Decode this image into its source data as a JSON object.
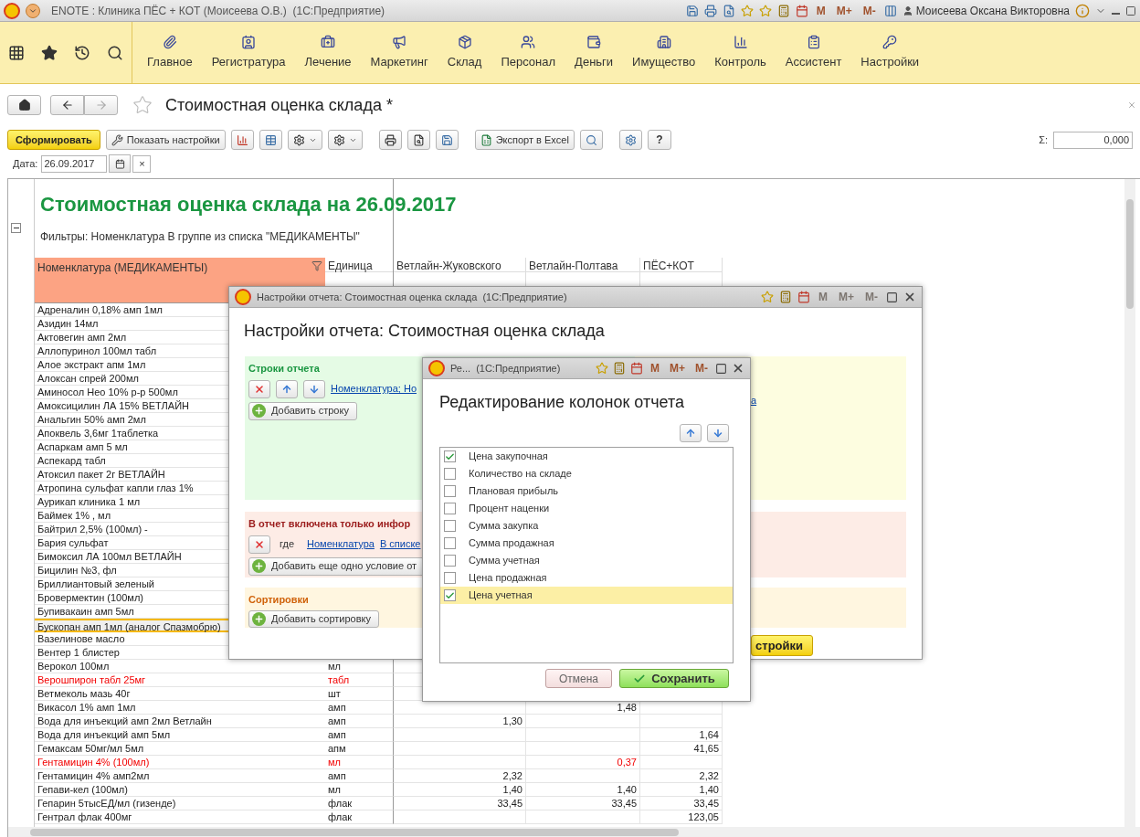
{
  "app_title_bar": {
    "title": "ENOTE : Клиника ПЁС + КОТ (Моисеева О.В.)  (1С:Предприятие)",
    "memory_buttons": [
      "M",
      "M+",
      "M-"
    ],
    "user": "Моисеева Оксана Викторовна"
  },
  "sections": [
    {
      "label": "Главное"
    },
    {
      "label": "Регистратура"
    },
    {
      "label": "Лечение"
    },
    {
      "label": "Маркетинг"
    },
    {
      "label": "Склад"
    },
    {
      "label": "Персонал"
    },
    {
      "label": "Деньги"
    },
    {
      "label": "Имущество"
    },
    {
      "label": "Контроль"
    },
    {
      "label": "Ассистент"
    },
    {
      "label": "Настройки"
    }
  ],
  "page": {
    "title": "Стоимостная оценка склада *"
  },
  "toolbar": {
    "generate_button": "Сформировать",
    "settings_button": "Показать настройки",
    "export_button": "Экспорт в Excel",
    "help_button": "?",
    "sum_label": "Σ:",
    "sum_value": "0,000"
  },
  "date_filter": {
    "label": "Дата:",
    "value": "26.09.2017",
    "clear": "×"
  },
  "report": {
    "title": "Стоимостная оценка склада на 26.09.2017",
    "filters": "Фильтры: Номенклатура В группе из списка \"МЕДИКАМЕНТЫ\"",
    "columns": [
      "Номенклатура (МЕДИКАМЕНТЫ)",
      "Единица",
      "Ветлайн-Жуковского",
      "Ветлайн-Полтава",
      "ПЁС+КОТ"
    ],
    "rows": [
      {
        "name": "Адреналин 0,18% амп 1мл",
        "flagged": false,
        "selected": false
      },
      {
        "name": "Азидин 14мл",
        "flagged": false,
        "selected": false
      },
      {
        "name": "Актовегин амп 2мл",
        "flagged": false,
        "selected": false
      },
      {
        "name": "Аллопуринол 100мл табл",
        "flagged": false,
        "selected": false
      },
      {
        "name": "Алое экстракт апм 1мл",
        "flagged": false,
        "selected": false
      },
      {
        "name": "Алоксан спрей 200мл",
        "flagged": false,
        "selected": false
      },
      {
        "name": "Аминосол Нео 10% р-р 500мл",
        "flagged": false,
        "selected": false
      },
      {
        "name": "Амоксицилин ЛА 15% ВЕТЛАЙН",
        "flagged": false,
        "selected": false
      },
      {
        "name": "Анальгин 50% амп 2мл",
        "flagged": false,
        "selected": false
      },
      {
        "name": "Апоквель 3,6мг 1таблетка",
        "flagged": false,
        "selected": false
      },
      {
        "name": "Аспаркам амп 5 мл",
        "flagged": false,
        "selected": false
      },
      {
        "name": "Аспекард табл",
        "flagged": false,
        "selected": false
      },
      {
        "name": "Атоксил пакет 2г ВЕТЛАЙН",
        "flagged": false,
        "selected": false
      },
      {
        "name": "Атропина сульфат капли глаз 1%",
        "flagged": false,
        "selected": false
      },
      {
        "name": "Аурикап клиника 1 мл",
        "flagged": false,
        "selected": false
      },
      {
        "name": "Баймек 1% , мл",
        "flagged": false,
        "selected": false
      },
      {
        "name": "Байтрил 2,5% (100мл) -",
        "flagged": false,
        "selected": false
      },
      {
        "name": "Бария сульфат",
        "flagged": false,
        "selected": false
      },
      {
        "name": "Бимоксил ЛА 100мл ВЕТЛАЙН",
        "flagged": false,
        "selected": false
      },
      {
        "name": "Бицилин №3, фл",
        "flagged": false,
        "selected": false
      },
      {
        "name": "Бриллиантовый зеленый",
        "flagged": false,
        "selected": false
      },
      {
        "name": "Бровермектин (100мл)",
        "flagged": false,
        "selected": false
      },
      {
        "name": "Бупивакаин амп 5мл",
        "flagged": false,
        "selected": false
      },
      {
        "name": "Бускопан амп 1мл (аналог Спазмобрю)",
        "flagged": false,
        "selected": true
      },
      {
        "name": "Вазелинове масло",
        "flagged": false,
        "selected": false
      },
      {
        "name": "Вентер 1 блистер",
        "flagged": false,
        "selected": false
      },
      {
        "name": "Верокол 100мл",
        "unit": "мл",
        "flagged": false,
        "selected": false
      },
      {
        "name": "Верошпирон табл 25мг",
        "unit": "табл",
        "flagged": true,
        "selected": false
      },
      {
        "name": "Ветмеколь мазь 40г",
        "unit": "шт",
        "flagged": false,
        "selected": false
      },
      {
        "name": "Викасол 1% амп 1мл",
        "unit": "амп",
        "poltava": "1,48",
        "flagged": false,
        "selected": false
      },
      {
        "name": "Вода для инъекций амп 2мл Ветлайн",
        "unit": "амп",
        "zhukovskogo": "1,30",
        "flagged": false,
        "selected": false
      },
      {
        "name": "Вода для инъекций амп 5мл",
        "unit": "амп",
        "pes_kot": "1,64",
        "flagged": false,
        "selected": false
      },
      {
        "name": "Гемаксам 50мг/мл 5мл",
        "unit": "апм",
        "pes_kot": "41,65",
        "flagged": false,
        "selected": false
      },
      {
        "name": "Гентамицин 4% (100мл)",
        "unit": "мл",
        "poltava": "0,37",
        "flagged": true,
        "selected": false
      },
      {
        "name": "Гентамицин 4% амп2мл",
        "unit": "амп",
        "zhukovskogo": "2,32",
        "pes_kot": "2,32",
        "flagged": false,
        "selected": false
      },
      {
        "name": "Гепави-кел (100мл)",
        "unit": "мл",
        "zhukovskogo": "1,40",
        "poltava": "1,40",
        "pes_kot": "1,40",
        "flagged": false,
        "selected": false
      },
      {
        "name": "Гепарин 5тысЕД/мл (гизенде)",
        "unit": "флак",
        "zhukovskogo": "33,45",
        "poltava": "33,45",
        "pes_kot": "33,45",
        "flagged": false,
        "selected": false
      },
      {
        "name": "Гентрал флак 400мг",
        "unit": "флак",
        "pes_kot": "123,05",
        "flagged": false,
        "selected": false
      }
    ]
  },
  "settings_dialog": {
    "window_title": "Настройки отчета: Стоимостная оценка склада  (1С:Предприятие)",
    "memory_buttons": [
      "M",
      "M+",
      "M-"
    ],
    "memory_disabled": true,
    "heading": "Настройки отчета: Стоимостная оценка склада",
    "rows_section": {
      "title": "Строки отчета",
      "link": "Номенклатура; Но",
      "add_button": "Добавить строку"
    },
    "columns_link": "а",
    "filter_section": {
      "title": "В отчет включена только инфор",
      "where": "где",
      "field_link": "Номенклатура",
      "condition_link": "В списке",
      "add_button": "Добавить еще одно условие от"
    },
    "sort_section": {
      "title": "Сортировки",
      "add_button": "Добавить сортировку"
    },
    "apply_button": "стройки"
  },
  "columns_dialog": {
    "window_title": "Ре...",
    "window_app": "(1С:Предприятие)",
    "memory_buttons": [
      "M",
      "M+",
      "M-"
    ],
    "memory_disabled": false,
    "heading": "Редактирование колонок отчета",
    "items": [
      {
        "label": "Цена закупочная",
        "checked": true,
        "selected": false
      },
      {
        "label": "Количество на складе",
        "checked": false,
        "selected": false
      },
      {
        "label": "Плановая прибыль",
        "checked": false,
        "selected": false
      },
      {
        "label": "Процент наценки",
        "checked": false,
        "selected": false
      },
      {
        "label": "Сумма закупка",
        "checked": false,
        "selected": false
      },
      {
        "label": "Сумма продажная",
        "checked": false,
        "selected": false
      },
      {
        "label": "Сумма учетная",
        "checked": false,
        "selected": false
      },
      {
        "label": "Цена продажная",
        "checked": false,
        "selected": false
      },
      {
        "label": "Цена учетная",
        "checked": true,
        "selected": true
      }
    ],
    "cancel_button": "Отмена",
    "save_button": "Сохранить"
  }
}
